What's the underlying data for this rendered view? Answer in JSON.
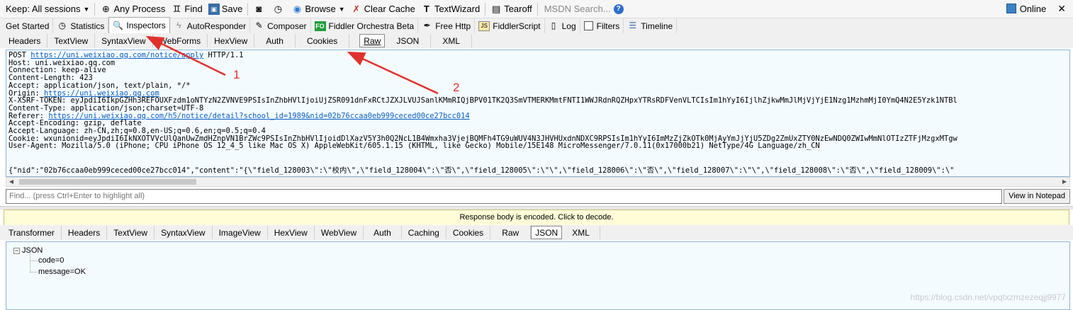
{
  "toolbar": {
    "keep_sessions": "Keep: All sessions",
    "any_process": "Any Process",
    "find": "Find",
    "save": "Save",
    "browse": "Browse",
    "clear_cache": "Clear Cache",
    "textwizard": "TextWizard",
    "tearoff": "Tearoff",
    "msdn_search": "MSDN Search...",
    "online": "Online"
  },
  "main_tabs": [
    {
      "label": "Get Started"
    },
    {
      "label": "Statistics"
    },
    {
      "label": "Inspectors"
    },
    {
      "label": "AutoResponder"
    },
    {
      "label": "Composer"
    },
    {
      "label": "Fiddler Orchestra Beta",
      "badge": "FO"
    },
    {
      "label": "Free Http"
    },
    {
      "label": "FiddlerScript",
      "badge": "JS"
    },
    {
      "label": "Log"
    },
    {
      "label": "Filters"
    },
    {
      "label": "Timeline"
    }
  ],
  "request_tabs": [
    "Headers",
    "TextView",
    "SyntaxView",
    "WebForms",
    "HexView",
    "Auth",
    "Cookies",
    "Raw",
    "JSON",
    "XML"
  ],
  "request_raw": {
    "line1_prefix": "POST ",
    "line1_url": "https://uni.weixiao.qq.com/notice/apply",
    "line1_suffix": " HTTP/1.1",
    "host": "Host: uni.weixiao.qq.com",
    "connection": "Connection: keep-alive",
    "content_length": "Content-Length: 423",
    "accept": "Accept: application/json, text/plain, */*",
    "origin_prefix": "Origin: ",
    "origin_url": "https://uni.weixiao.qq.com",
    "xsrf": "X-XSRF-TOKEN: eyJpdiI6IkpGZHh3REFOUXFzdm1oNTYzN2ZVNVE9PSIsInZhbHVlIjoiUjZSR091dnFxRCtJZXJLVUJSanlKMmRIQjBPV01TK2Q3SmVTMERKMmtFNTI1WWJRdnRQZHpxYTRsRDFVenVLTCIsIm1hYyI6IjlhZjkwMmJlMjVjYjE1Nzg1MzhmMjI0YmQ4N2E5Yzk1NTBl",
    "content_type": "Content-Type: application/json;charset=UTF-8",
    "referer_prefix": "Referer: ",
    "referer_url": "https://uni.weixiao.qq.com/h5/notice/detail?school_id=1989&nid=02b76ccaa0eb999ceced00ce27bcc014",
    "accept_encoding": "Accept-Encoding: gzip, deflate",
    "accept_language": "Accept-Language: zh-CN,zh;q=0.8,en-US;q=0.6,en;q=0.5;q=0.4",
    "cookie": "Cookie: wxunionid=eyJpdiI6IkNXOTVVcUlQanUwZmdHZnpVN1BrZWc9PSIsInZhbHVlIjoidDlXazV5Y3h0Q2NcL1B4Wmxha3VjejBQMFh4TG9uWUV4N3JHVHUxdnNDXC9RPSIsIm1hYyI6ImMzZjZkOTk0MjAyYmJjYjU5ZDg2ZmUxZTY0NzEwNDQ0ZWIwMmNlOTIzZTFjMzgxMTgw",
    "user_agent": "User-Agent: Mozilla/5.0 (iPhone; CPU iPhone OS 12_4_5 like Mac OS X) AppleWebKit/605.1.15 (KHTML, like Gecko) Mobile/15E148 MicroMessenger/7.0.11(0x17000b21) NetType/4G Language/zh_CN",
    "body": "{\"nid\":\"02b76ccaa0eb999ceced00ce27bcc014\",\"content\":\"{\\\"field_128003\\\":\\\"校内\\\",\\\"field_128004\\\":\\\"否\\\",\\\"field_128005\\\":\\\"\\\",\\\"field_128006\\\":\\\"否\\\",\\\"field_128007\\\":\\\"\\\",\\\"field_128008\\\":\\\"否\\\",\\\"field_128009\\\":\\\""
  },
  "find": {
    "placeholder": "Find... (press Ctrl+Enter to highlight all)",
    "view_in_notepad": "View in Notepad"
  },
  "response_banner": "Response body is encoded. Click to decode.",
  "response_tabs": [
    "Transformer",
    "Headers",
    "TextView",
    "SyntaxView",
    "ImageView",
    "HexView",
    "WebView",
    "Auth",
    "Caching",
    "Cookies",
    "Raw",
    "JSON",
    "XML"
  ],
  "json_tree": {
    "root": "JSON",
    "nodes": [
      "code=0",
      "message=OK"
    ]
  },
  "annotations": [
    "1",
    "2"
  ],
  "watermark": "https://blog.csdn.net/vpqtxzmzezeqjj9977",
  "colors": {
    "annotation": "#e0322c",
    "link": "#0a5ec2",
    "pane_bg": "#f4fbff",
    "banner_bg": "#fffdd8"
  }
}
